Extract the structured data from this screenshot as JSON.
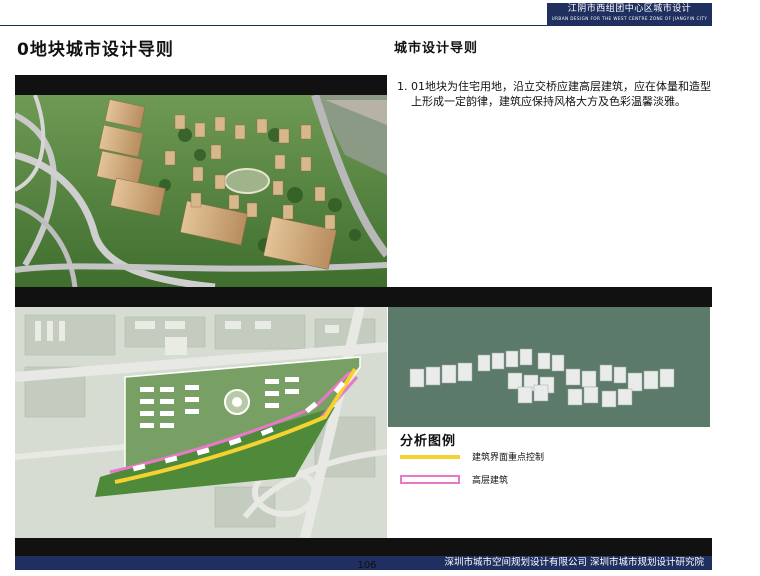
{
  "header": {
    "title_cn": "江阴市西组团中心区城市设计",
    "title_en": "URBAN DESIGN FOR THE WEST CENTRE ZONE OF JIANGYIN CITY"
  },
  "page_title": "0地块城市设计导则",
  "section_title": "城市设计导则",
  "guidelines": [
    {
      "num": "1.",
      "text": "01地块为住宅用地，沿立交桥应建高层建筑，应在体量和造型上形成一定韵律，建筑应保持风格大方及色彩温馨淡雅。"
    }
  ],
  "legend": {
    "title": "分析图例",
    "items": [
      {
        "label": "建筑界面重点控制",
        "color": "#f4d22f"
      },
      {
        "label": "高层建筑",
        "color": "#e878c8"
      }
    ]
  },
  "footer": {
    "organizations": "深圳市城市空间规划设计有限公司  深圳市城市规划设计研究院",
    "page_number": "106"
  }
}
